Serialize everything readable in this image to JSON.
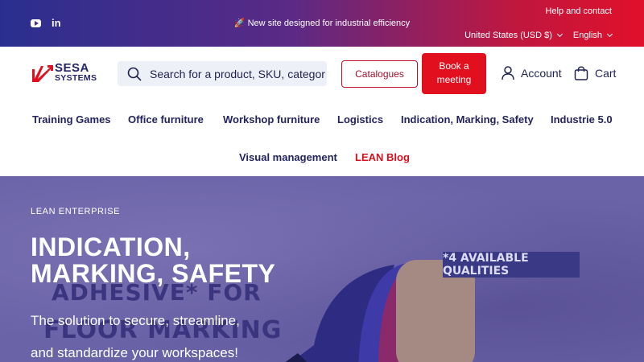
{
  "topbar": {
    "social_icons": [
      "youtube-icon",
      "linkedin-icon"
    ],
    "announcement": "🚀 New site designed for industrial efficiency",
    "help_link": "Help and contact",
    "currency": "United States (USD $)",
    "language": "English"
  },
  "header": {
    "logo_line1": "SESA",
    "logo_line2": "SYSTEMS",
    "search_placeholder": "Search for a product, SKU, category, ...",
    "catalogues_label": "Catalogues",
    "book_meeting_label": "Book a meeting",
    "account_label": "Account",
    "cart_label": "Cart"
  },
  "nav": {
    "items": [
      "Training Games",
      "Office furniture",
      "Workshop furniture",
      "Logistics",
      "Indication, Marking, Safety",
      "Industrie 5.0",
      "Visual management",
      "LEAN Blog"
    ]
  },
  "hero": {
    "eyebrow": "LEAN ENTERPRISE",
    "title": "INDICATION, MARKING, SAFETY",
    "subtitle": "The solution to secure, streamline, and standardize your workspaces!",
    "bg_text_1": "ADHESIVE* FOR",
    "bg_text_2": "FLOOR MARKING",
    "qualities_badge": "*4 AVAILABLE QUALITIES"
  },
  "colors": {
    "brand_navy": "#23235e",
    "brand_red": "#e20f1e",
    "hero_bg": "#6b63a8"
  }
}
